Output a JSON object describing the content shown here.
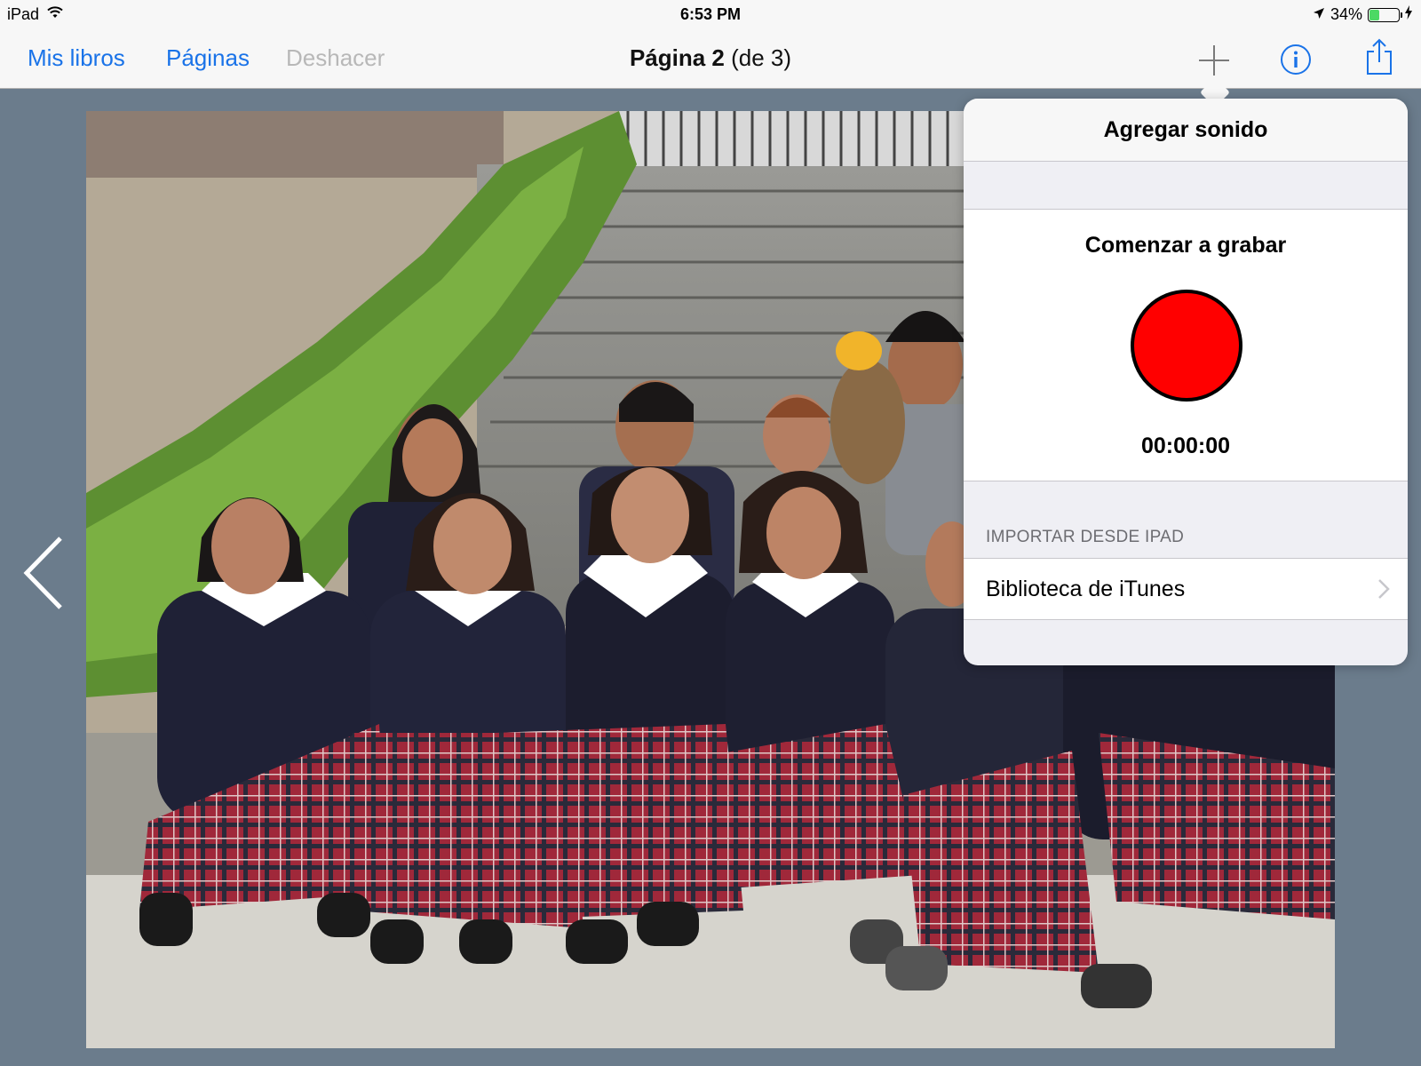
{
  "status_bar": {
    "device": "iPad",
    "time": "6:53 PM",
    "battery_text": "34%",
    "battery_level": 0.34
  },
  "nav": {
    "my_books": "Mis libros",
    "pages": "Páginas",
    "undo": "Deshacer",
    "title_bold": "Página 2",
    "title_rest": " (de 3)",
    "icons": [
      "add-icon",
      "info-icon",
      "share-icon"
    ]
  },
  "popover": {
    "title": "Agregar sonido",
    "record_title": "Comenzar a grabar",
    "record_time": "00:00:00",
    "import_section": "IMPORTAR DESDE IPAD",
    "itunes_row": "Biblioteca de iTunes"
  },
  "colors": {
    "accent": "#1a73e8",
    "record": "#ff0000",
    "background": "#6b7c8c"
  }
}
